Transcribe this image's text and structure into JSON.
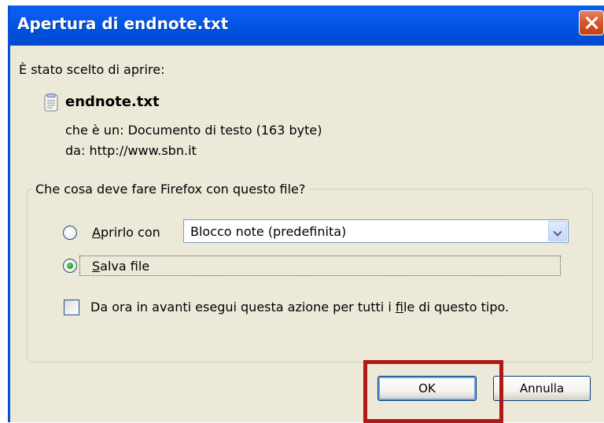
{
  "dialog": {
    "title": "Apertura di endnote.txt",
    "chosen_label": "È stato scelto di aprire:",
    "file_name": "endnote.txt",
    "type_label": "che è un:",
    "type_value": "Documento di testo (163 byte)",
    "from_label": "da:",
    "from_value": "http://www.sbn.it",
    "group_title": "Che cosa deve fare Firefox con questo file?",
    "open_option": {
      "accel": "A",
      "rest": "prirlo con",
      "selected": false
    },
    "app_select": {
      "value": "Blocco note (predefinita)"
    },
    "save_option": {
      "accel": "S",
      "rest": "alva file",
      "selected": true
    },
    "always_checkbox": {
      "before": "Da ora in avanti esegui questa azione per tutti i ",
      "accel": "f",
      "after": "ile di questo tipo.",
      "checked": false
    },
    "ok_button": "OK",
    "cancel_button": "Annulla"
  },
  "icons": {
    "close": "close-icon",
    "file": "text-file-icon",
    "dropdown": "chevron-down-icon"
  },
  "colors": {
    "titlebar": "#0052de",
    "dialog_bg": "#ece9d8",
    "highlight_box": "#b01818"
  }
}
